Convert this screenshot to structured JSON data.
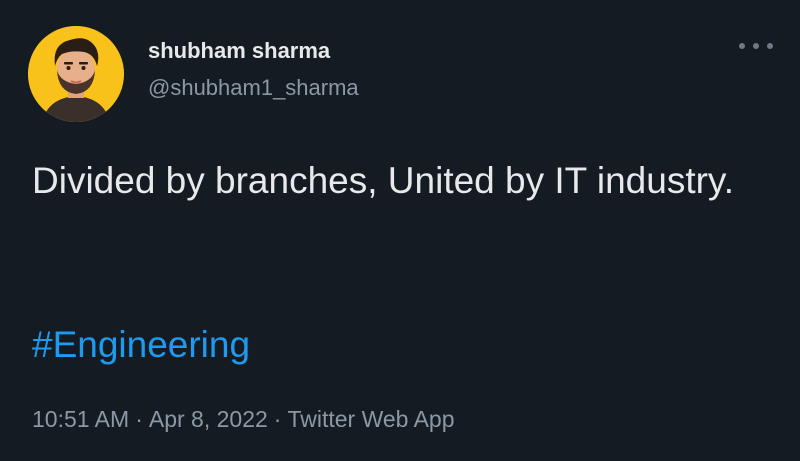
{
  "tweet": {
    "author": {
      "display_name": "shubham sharma",
      "handle": "@shubham1_sharma",
      "avatar_icon": "cartoon-avatar-icon",
      "avatar_bg": "#f8c21b"
    },
    "more_icon": "more-options-icon",
    "text": "Divided by branches, United by IT industry.",
    "hashtag": "#Engineering",
    "time": "10:51 AM",
    "date": "Apr 8, 2022",
    "source": "Twitter Web App",
    "separator": "·"
  },
  "colors": {
    "background": "#151b22",
    "primary_text": "#e7e9ea",
    "secondary_text": "#8b98a5",
    "link": "#1d9bf0"
  }
}
